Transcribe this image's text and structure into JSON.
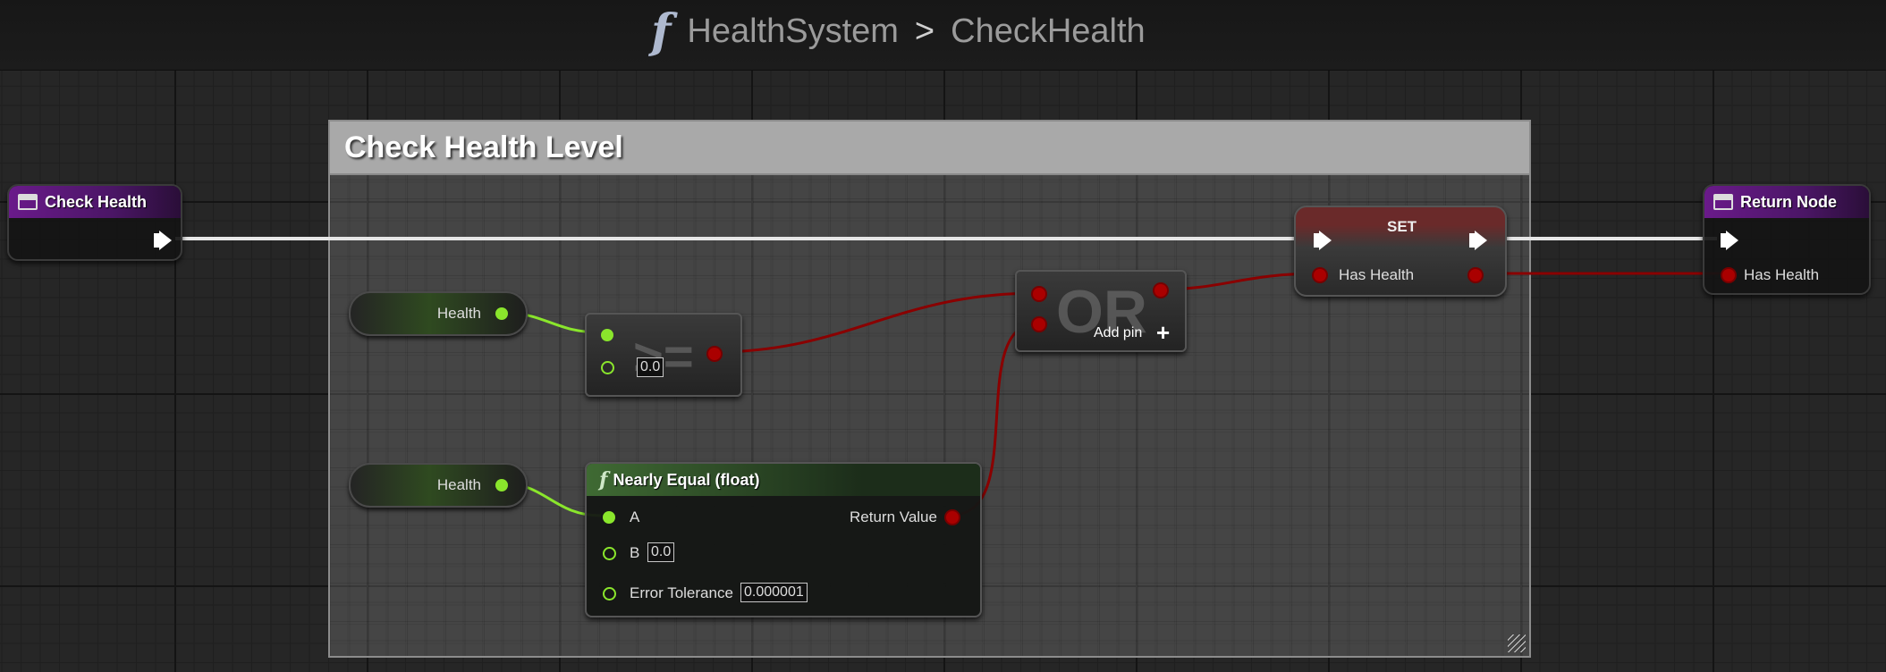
{
  "breadcrumb": {
    "icon": "function-icon",
    "parent": "HealthSystem",
    "separator": ">",
    "current": "CheckHealth"
  },
  "comment": {
    "title": "Check Health Level"
  },
  "nodes": {
    "entry": {
      "title": "Check Health",
      "icon": "function-entry-icon"
    },
    "getter_1": {
      "label": "Health"
    },
    "getter_2": {
      "label": "Health"
    },
    "compare": {
      "operator": ">=",
      "b_value": "0.0"
    },
    "or": {
      "operator": "OR",
      "add_pin_label": "Add pin",
      "add_icon": "+"
    },
    "set": {
      "title": "SET",
      "pin_label": "Has Health"
    },
    "nearly_equal": {
      "title": "Nearly Equal (float)",
      "pin_a": "A",
      "pin_b": "B",
      "b_value": "0.0",
      "pin_tolerance": "Error Tolerance",
      "tolerance_value": "0.000001",
      "return_label": "Return Value"
    },
    "return": {
      "title": "Return Node",
      "pin_label": "Has Health"
    }
  },
  "colors": {
    "exec": "#ffffff",
    "bool": "#990000",
    "float": "#8ae62c",
    "function_header": "#6a1a8a"
  }
}
